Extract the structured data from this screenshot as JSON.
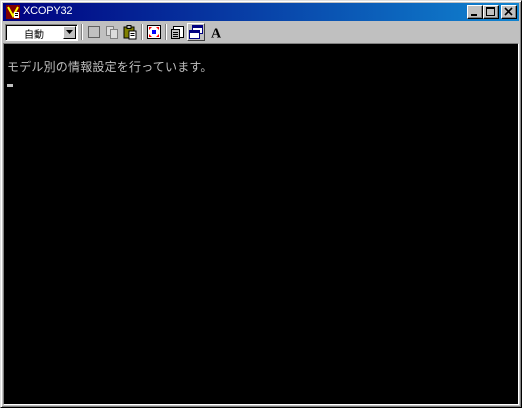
{
  "window": {
    "title": "XCOPY32"
  },
  "toolbar": {
    "mode_select_value": "自動",
    "buttons": [
      {
        "icon": "mark-icon"
      },
      {
        "icon": "copy-icon"
      },
      {
        "icon": "paste-icon"
      },
      {
        "icon": "fullscreen-icon"
      },
      {
        "icon": "properties-icon"
      },
      {
        "icon": "background-icon"
      },
      {
        "icon": "font-icon",
        "label": "A"
      }
    ]
  },
  "console": {
    "lines": [
      "モデル別の情報設定を行っています。"
    ]
  },
  "colors": {
    "titlebar_start": "#000080",
    "titlebar_end": "#1084d0",
    "console_bg": "#000000",
    "console_text": "#c0c0c0"
  }
}
